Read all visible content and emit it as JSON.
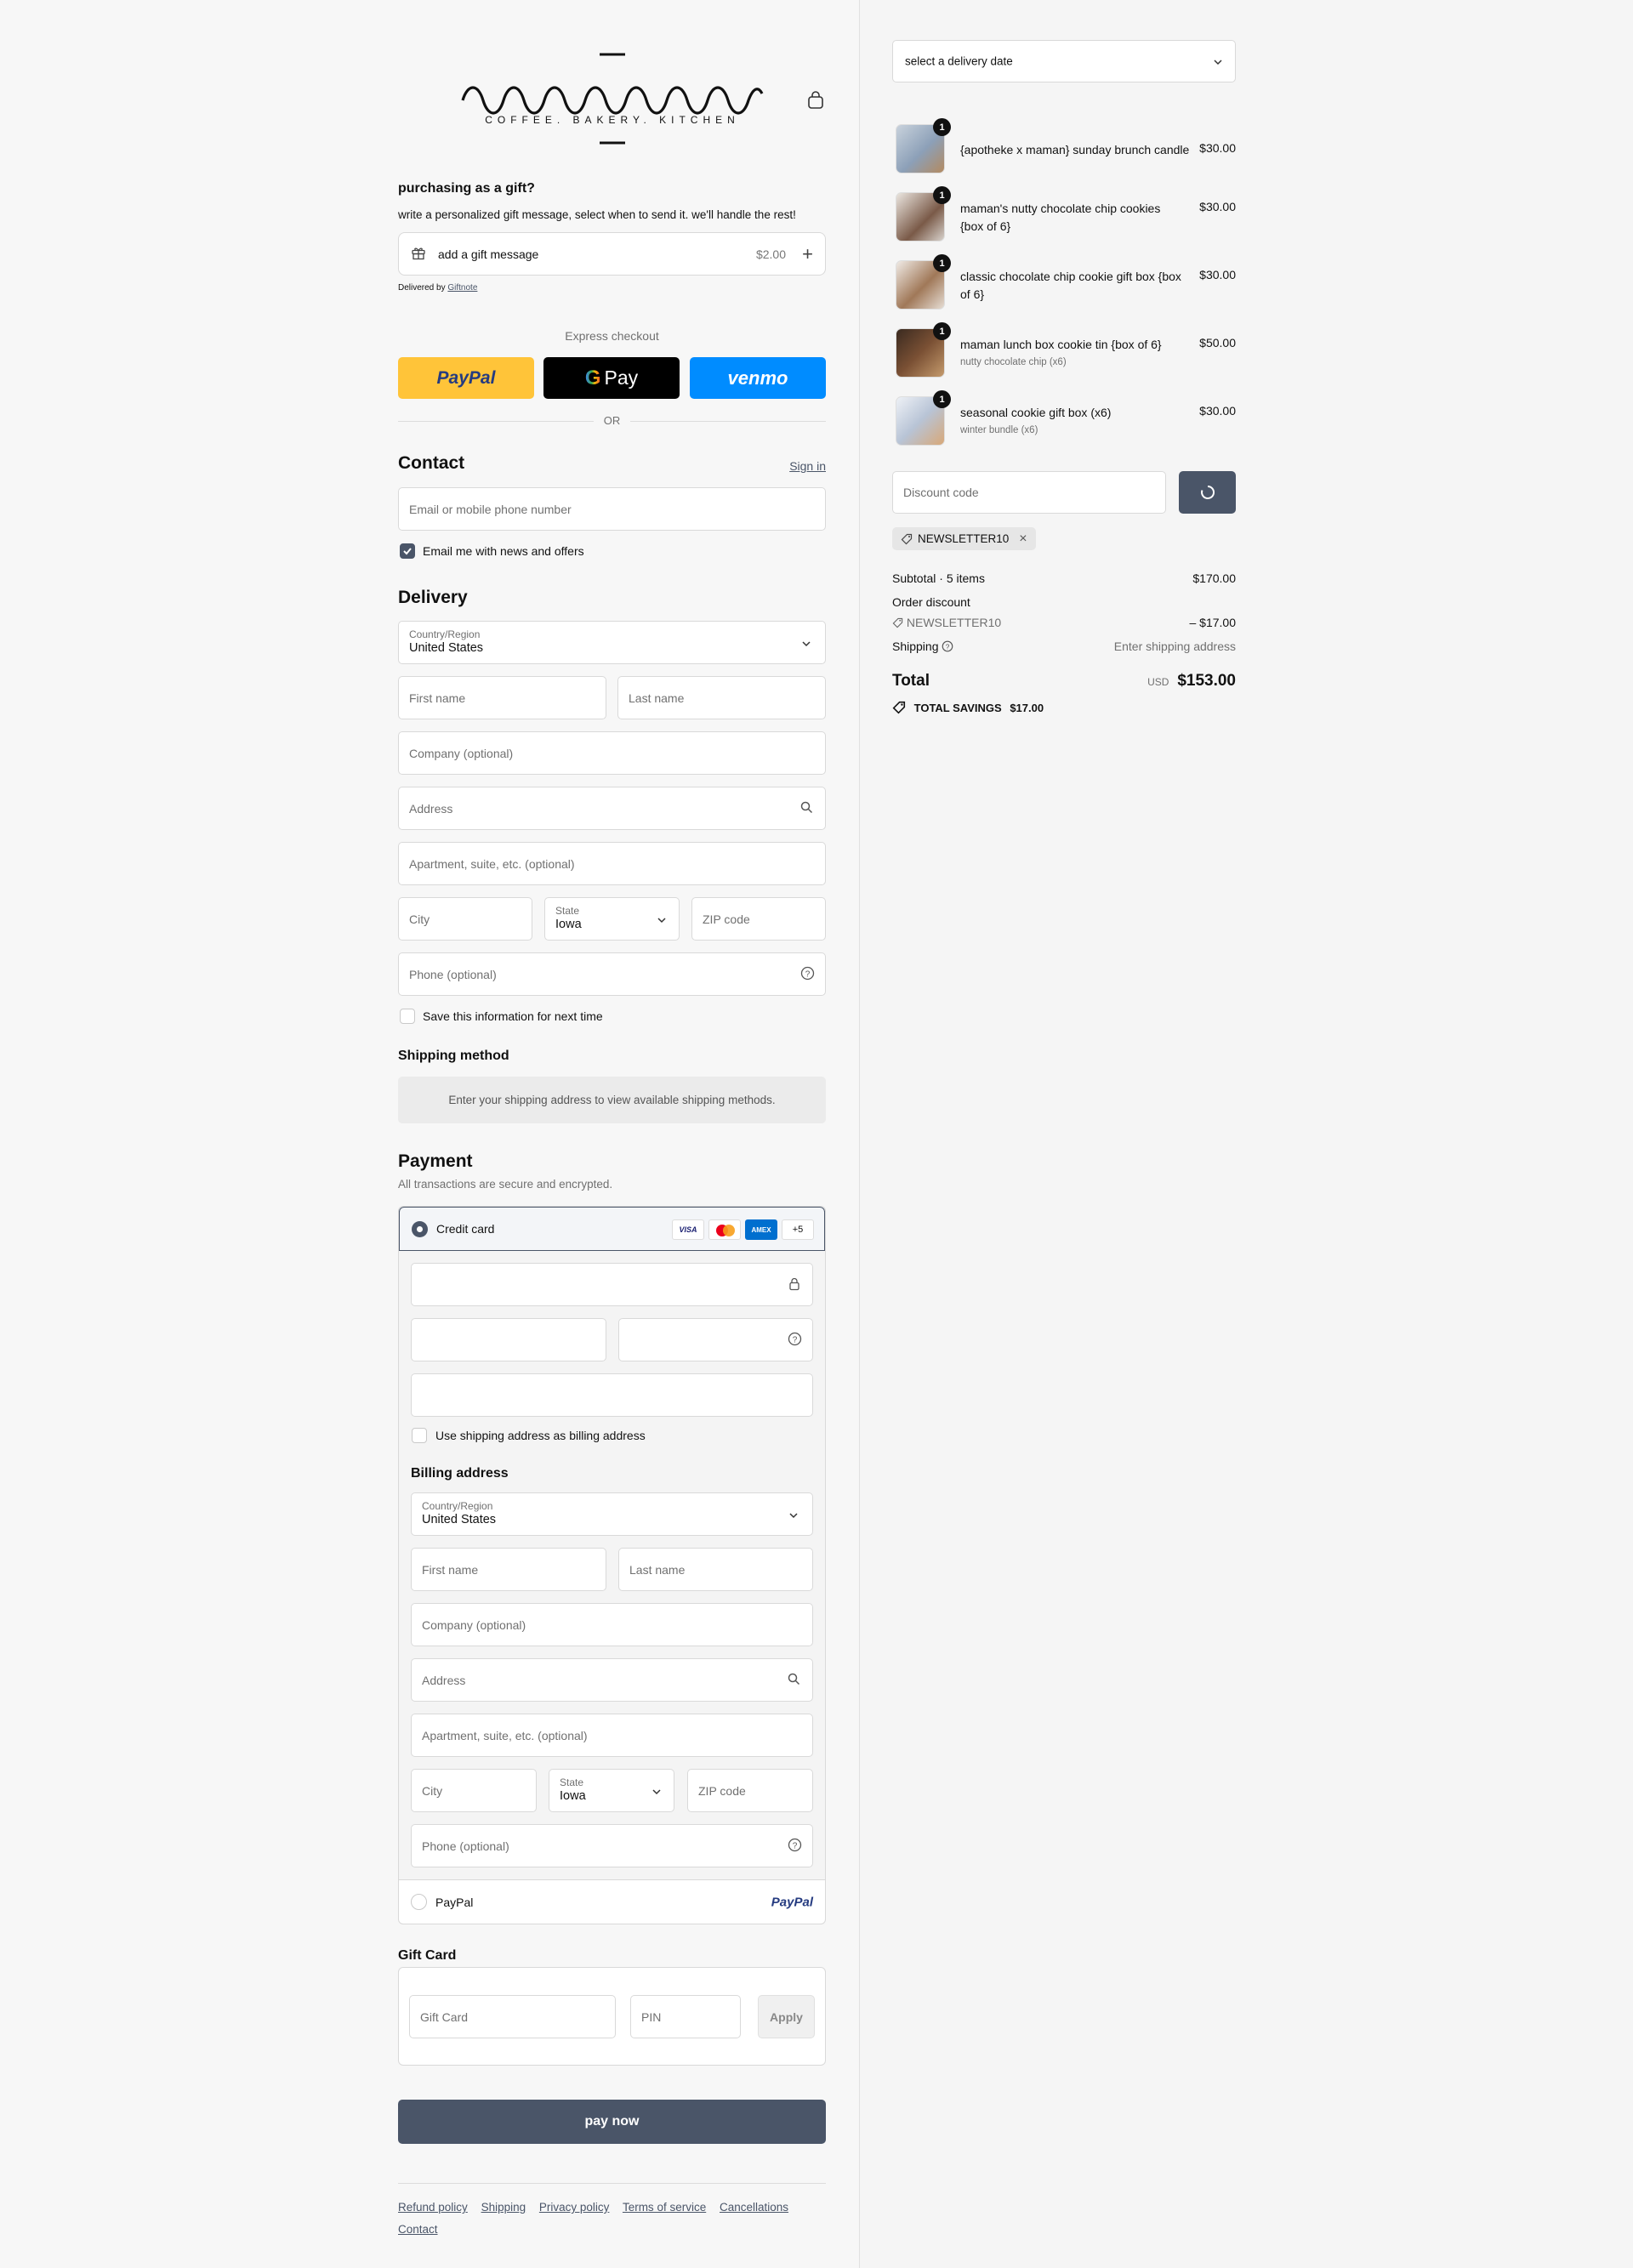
{
  "brand": {
    "logo_wordmark": "maman",
    "tagline": "COFFEE. BAKERY. KITCHEN"
  },
  "gift": {
    "heading": "purchasing as a gift?",
    "description": "write a personalized gift message, select when to send it. we'll handle the rest!",
    "add_label": "add a gift message",
    "price": "$2.00",
    "delivered_by_prefix": "Delivered by",
    "delivered_by_link": "Giftnote"
  },
  "express": {
    "heading": "Express checkout",
    "paypal_label": "PayPal",
    "gpay_label": "Pay",
    "venmo_label": "venmo",
    "or_label": "OR"
  },
  "contact": {
    "heading": "Contact",
    "sign_in": "Sign in",
    "email_placeholder": "Email or mobile phone number",
    "newsletter_label": "Email me with news and offers"
  },
  "delivery": {
    "heading": "Delivery",
    "country_label": "Country/Region",
    "country_value": "United States",
    "first_name": "First name",
    "last_name": "Last name",
    "company": "Company (optional)",
    "address": "Address",
    "apartment": "Apartment, suite, etc. (optional)",
    "city": "City",
    "state_label": "State",
    "state_value": "Iowa",
    "zip": "ZIP code",
    "phone": "Phone (optional)",
    "save_info": "Save this information for next time"
  },
  "shipping_method": {
    "heading": "Shipping method",
    "notice": "Enter your shipping address to view available shipping methods."
  },
  "payment": {
    "heading": "Payment",
    "subtitle": "All transactions are secure and encrypted.",
    "credit_card_label": "Credit card",
    "card_brands": [
      "VISA",
      "MC",
      "AMEX"
    ],
    "more_cards": "+5",
    "use_shipping_label": "Use shipping address as billing address",
    "billing_heading": "Billing address",
    "paypal_option": "PayPal",
    "paypal_logo": "PayPal"
  },
  "billing": {
    "country_label": "Country/Region",
    "country_value": "United States",
    "first_name": "First name",
    "last_name": "Last name",
    "company": "Company (optional)",
    "address": "Address",
    "apartment": "Apartment, suite, etc. (optional)",
    "city": "City",
    "state_label": "State",
    "state_value": "Iowa",
    "zip": "ZIP code",
    "phone": "Phone (optional)"
  },
  "gift_card": {
    "heading": "Gift Card",
    "card_placeholder": "Gift Card",
    "pin_placeholder": "PIN",
    "apply": "Apply"
  },
  "pay_now": "pay now",
  "footer_links": [
    "Refund policy",
    "Shipping",
    "Privacy policy",
    "Terms of service",
    "Cancellations",
    "Contact"
  ],
  "summary": {
    "delivery_date_placeholder": "select a delivery date",
    "items": [
      {
        "name": "{apotheke x maman} sunday brunch candle",
        "variant": "",
        "price": "$30.00",
        "qty": "1"
      },
      {
        "name": "maman's nutty chocolate chip cookies {box of 6}",
        "variant": "",
        "price": "$30.00",
        "qty": "1"
      },
      {
        "name": "classic chocolate chip cookie gift box {box of 6}",
        "variant": "",
        "price": "$30.00",
        "qty": "1"
      },
      {
        "name": "maman lunch box cookie tin {box of 6}",
        "variant": "nutty chocolate chip (x6)",
        "price": "$50.00",
        "qty": "1"
      },
      {
        "name": "seasonal cookie gift box (x6)",
        "variant": "winter bundle (x6)",
        "price": "$30.00",
        "qty": "1"
      }
    ],
    "discount_placeholder": "Discount code",
    "applied_code": "NEWSLETTER10",
    "subtotal_label": "Subtotal · 5 items",
    "subtotal_value": "$170.00",
    "order_discount_label": "Order discount",
    "discount_code": "NEWSLETTER10",
    "discount_value": "– $17.00",
    "shipping_label": "Shipping",
    "shipping_value": "Enter shipping address",
    "total_label": "Total",
    "currency": "USD",
    "total_value": "$153.00",
    "savings_label": "TOTAL SAVINGS",
    "savings_value": "$17.00"
  },
  "colors": {
    "accent": "#4a5568",
    "paypal_yellow": "#ffc439",
    "venmo_blue": "#008cff"
  }
}
